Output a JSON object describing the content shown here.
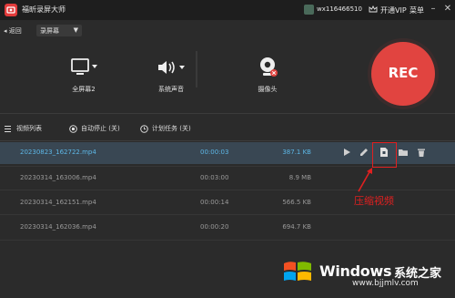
{
  "app": {
    "title": "福昕录屏大师",
    "user": "wx116466510",
    "vip": "开通VIP",
    "menu": "菜单"
  },
  "toolbar": {
    "back": "返回",
    "mode": "录屏幕"
  },
  "sources": [
    {
      "label": "全屏幕2",
      "icon": "monitor-icon"
    },
    {
      "label": "系统声音",
      "icon": "speaker-icon"
    },
    {
      "label": "摄像头",
      "icon": "webcam-icon"
    }
  ],
  "rec": {
    "label": "REC",
    "color": "#e14440"
  },
  "bottom_toolbar": {
    "list": "视频列表",
    "auto_stop": "自动停止 (关)",
    "schedule": "计划任务 (关)"
  },
  "files": [
    {
      "name": "20230823_162722.mp4",
      "duration": "00:00:03",
      "size": "387.1 KB",
      "selected": true
    },
    {
      "name": "20230314_163006.mp4",
      "duration": "00:03:00",
      "size": "8.9 MB",
      "selected": false
    },
    {
      "name": "20230314_162151.mp4",
      "duration": "00:00:14",
      "size": "566.5 KB",
      "selected": false
    },
    {
      "name": "20230314_162036.mp4",
      "duration": "00:00:20",
      "size": "694.7 KB",
      "selected": false
    }
  ],
  "annotation": {
    "label": "压缩视频",
    "color": "#e02020"
  },
  "watermark": {
    "brand": "Windows",
    "subtitle": "系统之家",
    "url": "www.bjjmlv.com"
  }
}
